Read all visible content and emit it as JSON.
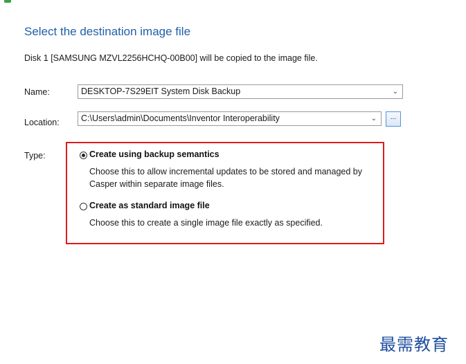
{
  "header": {
    "title": "Select the destination image file",
    "description": "Disk 1 [SAMSUNG MZVL2256HCHQ-00B00] will be copied to the image file."
  },
  "form": {
    "name_label": "Name:",
    "name_value": "DESKTOP-7S29EIT System Disk Backup",
    "location_label": "Location:",
    "location_value": "C:\\Users\\admin\\Documents\\Inventor Interoperability",
    "browse_label": "...",
    "type_label": "Type:"
  },
  "options": [
    {
      "title": "Create using backup semantics",
      "description": "Choose this to allow incremental updates to be stored and managed by Casper within separate image files.",
      "selected": true
    },
    {
      "title": "Create as standard image file",
      "description": "Choose this to create a single image file exactly as specified.",
      "selected": false
    }
  ],
  "watermark": "最需教育",
  "colors": {
    "title": "#1f5fa8",
    "highlight_box": "#e11a1a",
    "watermark": "#1f4ea0"
  }
}
